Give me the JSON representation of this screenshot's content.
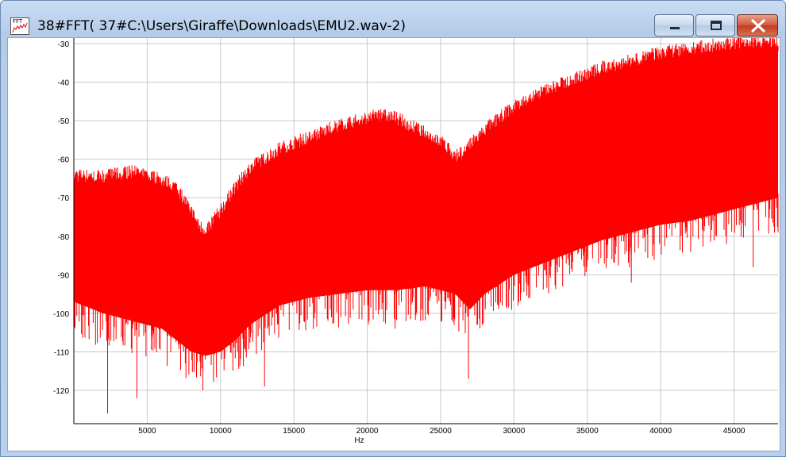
{
  "window": {
    "title": "38#FFT( 37#C:\\Users\\Giraffe\\Downloads\\EMU2.wav-2)",
    "icon_label": "FFT",
    "icon": "fft-chart-icon",
    "minimize_icon": "minimize-icon",
    "maximize_icon": "maximize-icon",
    "close_icon": "close-icon"
  },
  "colors": {
    "trace": "#ff0000",
    "grid": "#c8c8c8",
    "close_button": "#c9452a"
  },
  "chart_data": {
    "type": "area",
    "xlabel": "Hz",
    "ylabel": "",
    "xlim": [
      0,
      48000
    ],
    "ylim": [
      -128,
      -30
    ],
    "grid": true,
    "x_ticks": [
      5000,
      10000,
      15000,
      20000,
      25000,
      30000,
      35000,
      40000,
      45000
    ],
    "y_ticks": [
      -30,
      -40,
      -50,
      -60,
      -70,
      -80,
      -90,
      -100,
      -110,
      -120
    ],
    "upper_envelope": {
      "x": [
        0,
        2000,
        4000,
        6000,
        7000,
        8000,
        8500,
        9000,
        10000,
        11000,
        12000,
        14000,
        16000,
        18000,
        20000,
        21000,
        22000,
        23000,
        24000,
        25000,
        26000,
        26500,
        27000,
        28000,
        30000,
        32000,
        34000,
        36000,
        38000,
        40000,
        42000,
        44000,
        46000,
        48000
      ],
      "values": [
        -66,
        -66,
        -65,
        -67,
        -69,
        -75,
        -79,
        -80,
        -75,
        -69,
        -64,
        -59,
        -56,
        -53,
        -51,
        -50,
        -51,
        -53,
        -55,
        -57,
        -61,
        -60,
        -58,
        -54,
        -48,
        -44,
        -41,
        -38,
        -36,
        -34,
        -33,
        -32,
        -31,
        -31
      ]
    },
    "lower_envelope": {
      "x": [
        0,
        2000,
        4000,
        6000,
        7000,
        8000,
        9000,
        10000,
        11000,
        12000,
        14000,
        16000,
        18000,
        20000,
        22000,
        24000,
        26000,
        27000,
        28000,
        30000,
        32000,
        34000,
        36000,
        38000,
        40000,
        42000,
        44000,
        46000,
        48000
      ],
      "values": [
        -97,
        -100,
        -102,
        -104,
        -107,
        -110,
        -111,
        -110,
        -107,
        -103,
        -98,
        -96,
        -95,
        -94,
        -94,
        -93,
        -95,
        -99,
        -95,
        -90,
        -87,
        -84,
        -81,
        -79,
        -77,
        -76,
        -74,
        -72,
        -70
      ]
    },
    "min_spikes": {
      "x": [
        2300,
        4300,
        8800,
        13000,
        21900,
        26900,
        29200,
        38000,
        46300
      ],
      "values": [
        -126,
        -122,
        -120,
        -119,
        -104,
        -117,
        -98,
        -92,
        -88
      ]
    }
  }
}
